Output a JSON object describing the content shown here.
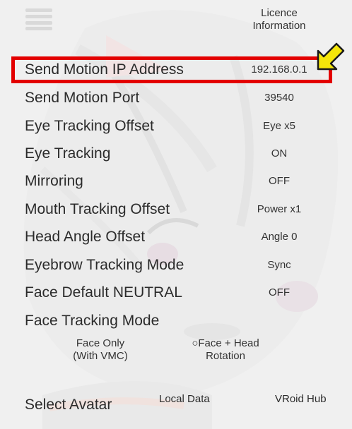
{
  "header": {
    "licence_line1": "Licence",
    "licence_line2": "Information"
  },
  "settings": [
    {
      "label": "Send Motion IP Address",
      "value": "192.168.0.1"
    },
    {
      "label": "Send Motion Port",
      "value": "39540"
    },
    {
      "label": "Eye Tracking Offset",
      "value": "Eye x5"
    },
    {
      "label": "Eye Tracking",
      "value": "ON"
    },
    {
      "label": "Mirroring",
      "value": "OFF"
    },
    {
      "label": "Mouth Tracking Offset",
      "value": "Power x1"
    },
    {
      "label": "Head Angle Offset",
      "value": "Angle 0"
    },
    {
      "label": "Eyebrow Tracking Mode",
      "value": "Sync"
    },
    {
      "label": "Face Default NEUTRAL",
      "value": "OFF"
    }
  ],
  "face_tracking": {
    "label": "Face Tracking Mode",
    "option1_line1": "Face Only",
    "option1_line2": "(With VMC)",
    "option2_line1": "○Face + Head",
    "option2_line2": "Rotation"
  },
  "avatar": {
    "label": "Select Avatar",
    "local": "Local Data",
    "vroid": "VRoid Hub"
  },
  "colors": {
    "highlight": "#e30000",
    "arrow": "#f5e60a"
  }
}
